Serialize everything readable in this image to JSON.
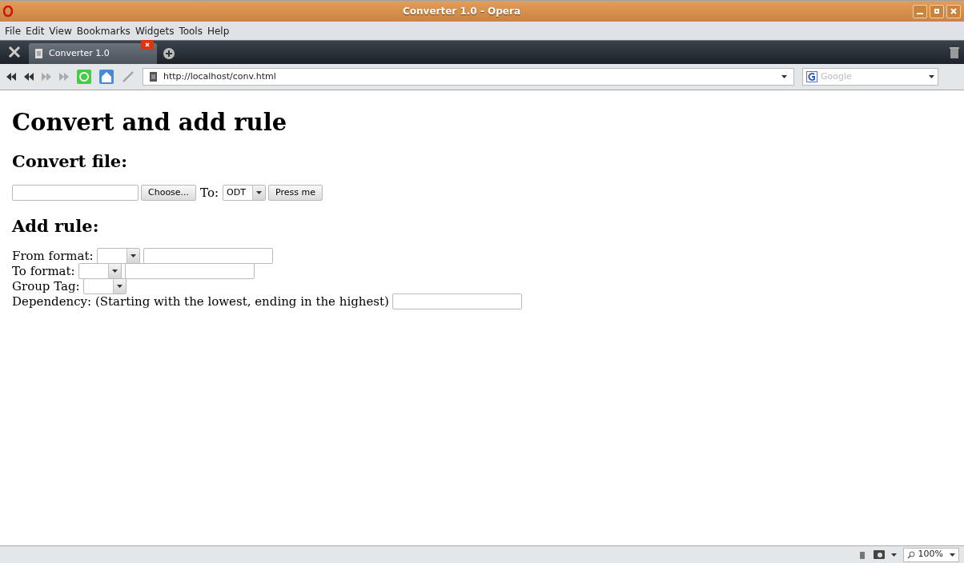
{
  "window": {
    "title": "Converter 1.0 - Opera"
  },
  "menu": [
    "File",
    "Edit",
    "View",
    "Bookmarks",
    "Widgets",
    "Tools",
    "Help"
  ],
  "tabs": [
    {
      "label": "Converter 1.0",
      "selected": true
    }
  ],
  "address": {
    "url": "http://localhost/conv.html"
  },
  "search": {
    "placeholder": "Google"
  },
  "page": {
    "title": "Convert and add rule",
    "convert": {
      "heading": "Convert file:",
      "choose_button": "Choose...",
      "to_label": "To:",
      "format_select": "ODT",
      "submit_button": "Press me"
    },
    "add_rule": {
      "heading": "Add rule:",
      "rows": [
        {
          "label": "From format:",
          "kind": "select_text"
        },
        {
          "label": "To format:",
          "kind": "select_text"
        },
        {
          "label": "Group Tag:",
          "kind": "select"
        },
        {
          "label": "Dependency: (Starting with the lowest, ending in the highest)",
          "kind": "text"
        }
      ]
    }
  },
  "status_bar": {
    "zoom": "100%"
  }
}
